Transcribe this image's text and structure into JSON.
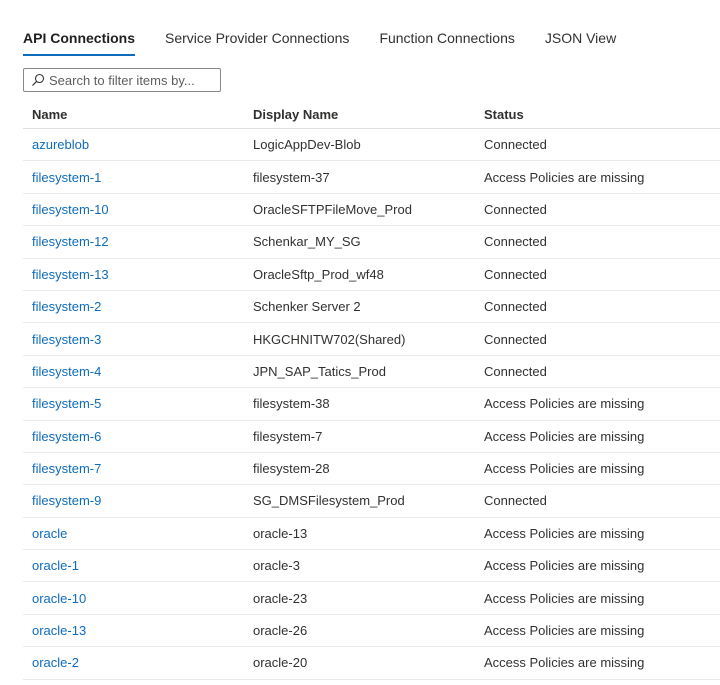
{
  "tabs": [
    {
      "label": "API Connections",
      "active": true
    },
    {
      "label": "Service Provider Connections",
      "active": false
    },
    {
      "label": "Function Connections",
      "active": false
    },
    {
      "label": "JSON View",
      "active": false
    }
  ],
  "search": {
    "placeholder": "Search to filter items by..."
  },
  "table": {
    "columns": [
      "Name",
      "Display Name",
      "Status"
    ],
    "rows": [
      {
        "name": "azureblob",
        "display_name": "LogicAppDev-Blob",
        "status": "Connected"
      },
      {
        "name": "filesystem-1",
        "display_name": "filesystem-37",
        "status": "Access Policies are missing"
      },
      {
        "name": "filesystem-10",
        "display_name": "OracleSFTPFileMove_Prod",
        "status": "Connected"
      },
      {
        "name": "filesystem-12",
        "display_name": "Schenkar_MY_SG",
        "status": "Connected"
      },
      {
        "name": "filesystem-13",
        "display_name": "OracleSftp_Prod_wf48",
        "status": "Connected"
      },
      {
        "name": "filesystem-2",
        "display_name": "Schenker Server 2",
        "status": "Connected"
      },
      {
        "name": "filesystem-3",
        "display_name": "HKGCHNITW702(Shared)",
        "status": "Connected"
      },
      {
        "name": "filesystem-4",
        "display_name": "JPN_SAP_Tatics_Prod",
        "status": "Connected"
      },
      {
        "name": "filesystem-5",
        "display_name": "filesystem-38",
        "status": "Access Policies are missing"
      },
      {
        "name": "filesystem-6",
        "display_name": "filesystem-7",
        "status": "Access Policies are missing"
      },
      {
        "name": "filesystem-7",
        "display_name": "filesystem-28",
        "status": "Access Policies are missing"
      },
      {
        "name": "filesystem-9",
        "display_name": "SG_DMSFilesystem_Prod",
        "status": "Connected"
      },
      {
        "name": "oracle",
        "display_name": "oracle-13",
        "status": "Access Policies are missing"
      },
      {
        "name": "oracle-1",
        "display_name": "oracle-3",
        "status": "Access Policies are missing"
      },
      {
        "name": "oracle-10",
        "display_name": "oracle-23",
        "status": "Access Policies are missing"
      },
      {
        "name": "oracle-13",
        "display_name": "oracle-26",
        "status": "Access Policies are missing"
      },
      {
        "name": "oracle-2",
        "display_name": "oracle-20",
        "status": "Access Policies are missing"
      }
    ]
  },
  "colors": {
    "accent": "#0f6cbd",
    "text": "#323130",
    "border": "#edebe9"
  }
}
